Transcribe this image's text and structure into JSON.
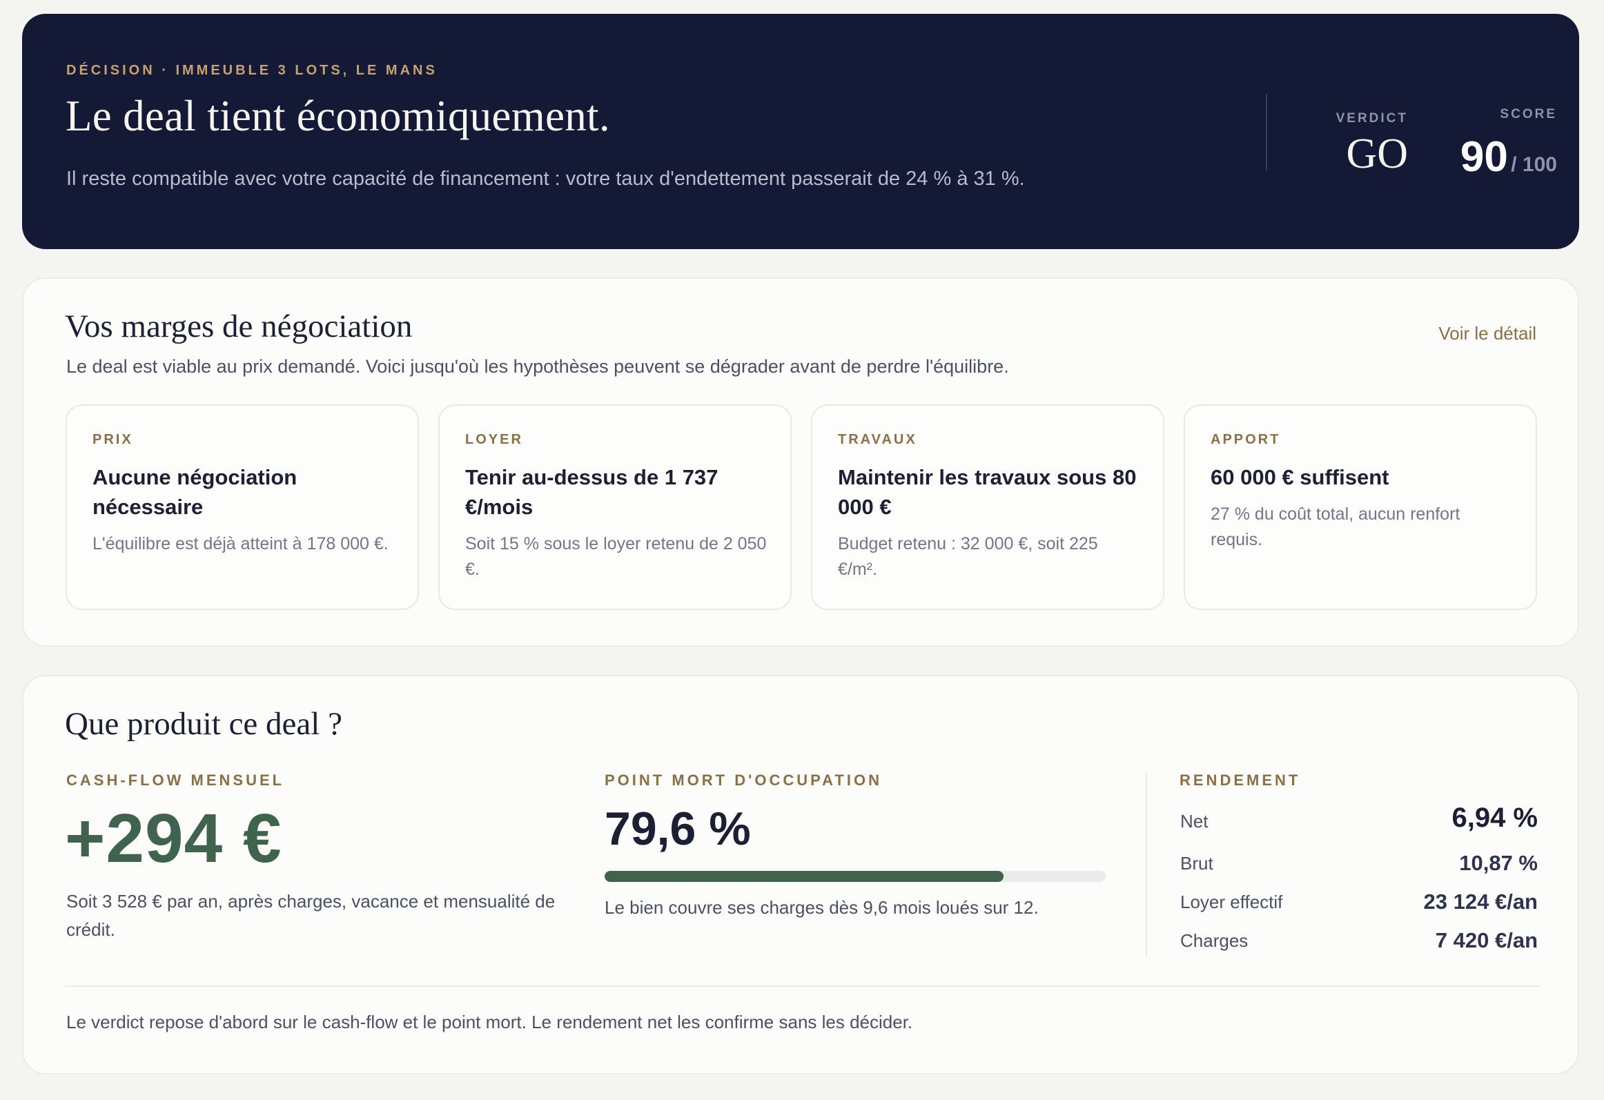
{
  "hero": {
    "kicker": "DÉCISION · IMMEUBLE 3 LOTS, LE MANS",
    "title": "Le deal tient économiquement.",
    "subtitle": "Il reste compatible avec votre capacité de financement : votre taux d'endettement passerait de 24 % à 31 %.",
    "verdict_label": "VERDICT",
    "verdict_value": "GO",
    "score_label": "SCORE",
    "score_value": "90",
    "score_max": "/ 100",
    "colors": {
      "background": "#141a36",
      "accent": "#c6a26c"
    }
  },
  "margins": {
    "title": "Vos marges de négociation",
    "description": "Le deal est viable au prix demandé. Voici jusqu'où les hypothèses peuvent se dégrader avant de perdre l'équilibre.",
    "detail_link": "Voir le détail",
    "tiles": [
      {
        "label": "PRIX",
        "headline": "Aucune négociation nécessaire",
        "text": "L'équilibre est déjà atteint à 178 000 €."
      },
      {
        "label": "LOYER",
        "headline": "Tenir au-dessus de 1 737 €/mois",
        "text": "Soit 15 % sous le loyer retenu de 2 050 €."
      },
      {
        "label": "TRAVAUX",
        "headline": "Maintenir les travaux sous 80 000 €",
        "text": "Budget retenu : 32 000 €, soit 225 €/m²."
      },
      {
        "label": "APPORT",
        "headline": "60 000 € suffisent",
        "text": "27 % du coût total, aucun renfort requis."
      }
    ]
  },
  "production": {
    "title": "Que produit ce deal ?",
    "cashflow": {
      "label": "CASH-FLOW MENSUEL",
      "value": "+294 €",
      "text": "Soit 3 528 € par an, après charges, vacance et mensualité de crédit.",
      "color": "#3f634d"
    },
    "break_even": {
      "label": "POINT MORT D'OCCUPATION",
      "value": "79,6 %",
      "progress_percent": 79.6,
      "text": "Le bien couvre ses charges dès 9,6 mois loués sur 12."
    },
    "yield": {
      "label": "RENDEMENT",
      "rows": [
        {
          "key": "Net",
          "value": "6,94 %"
        },
        {
          "key": "Brut",
          "value": "10,87 %"
        },
        {
          "key": "Loyer effectif",
          "value": "23 124 €/an"
        },
        {
          "key": "Charges",
          "value": "7 420 €/an"
        }
      ]
    },
    "footnote": "Le verdict repose d'abord sur le cash-flow et le point mort. Le rendement net les confirme sans les décider."
  }
}
